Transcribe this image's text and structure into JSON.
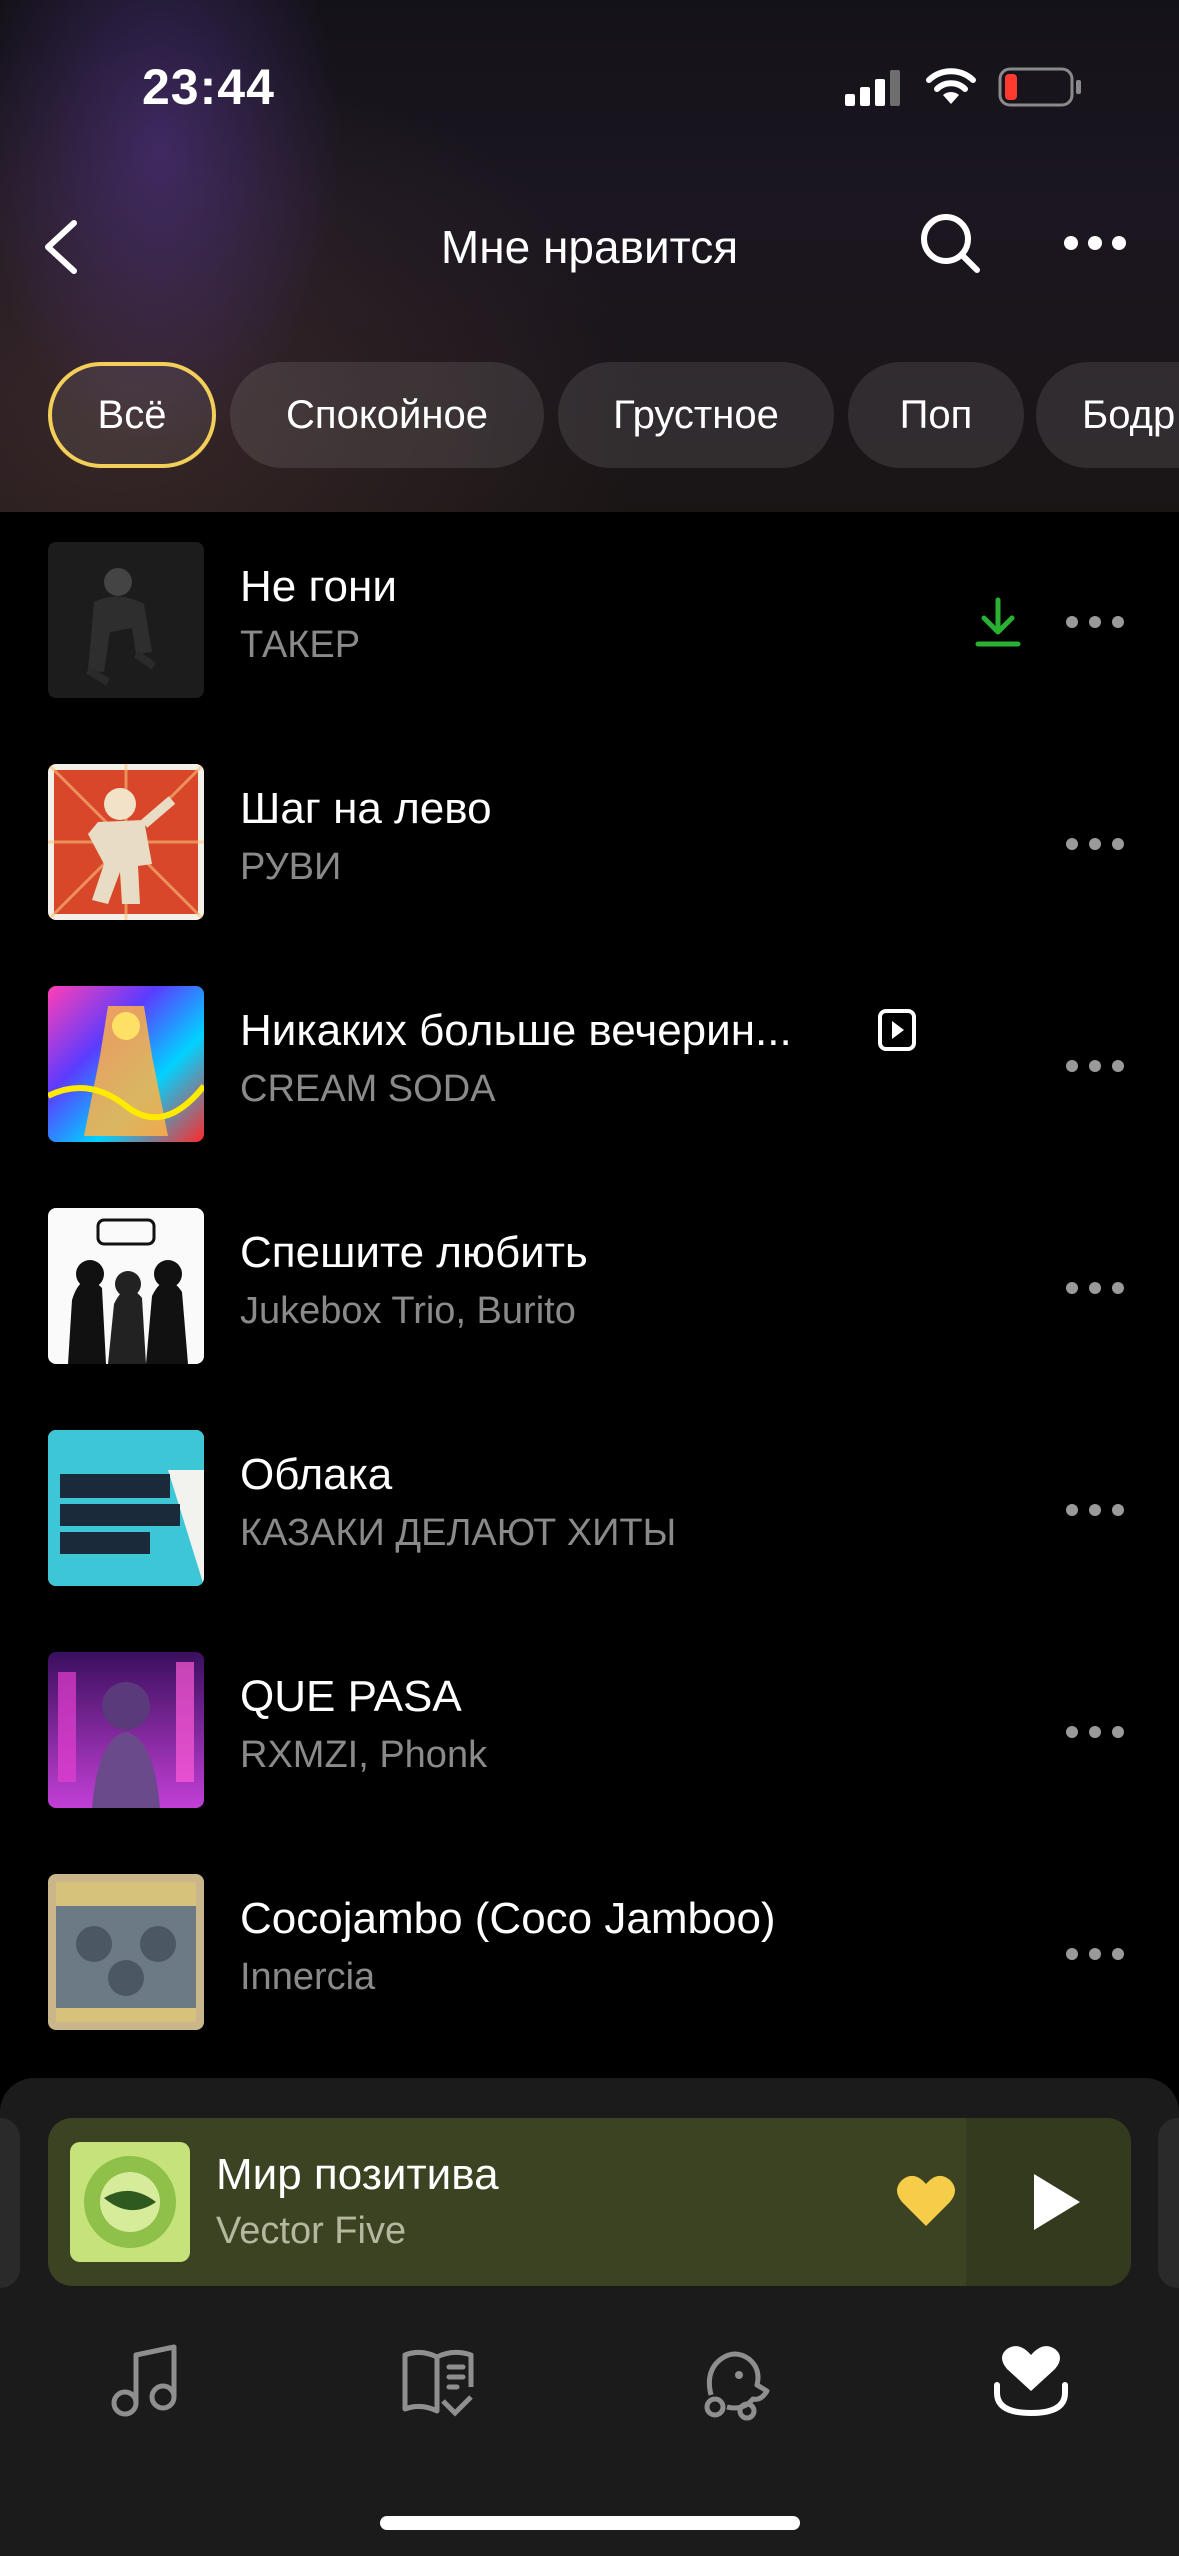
{
  "status_bar": {
    "time": "23:44"
  },
  "header": {
    "title": "Мне нравится"
  },
  "filters": [
    {
      "label": "Всё",
      "active": true
    },
    {
      "label": "Спокойное",
      "active": false
    },
    {
      "label": "Грустное",
      "active": false
    },
    {
      "label": "Поп",
      "active": false
    },
    {
      "label": "Бодр",
      "active": false
    }
  ],
  "tracks": [
    {
      "title": "Не гони",
      "artist": "ТАКЕР",
      "downloaded": true,
      "cover_icon": "album-cover-taker"
    },
    {
      "title": "Шаг на лево",
      "artist": "РУВИ",
      "cover_icon": "album-cover-ruvi"
    },
    {
      "title": "Никаких больше вечерин...",
      "artist": "CREAM SODA",
      "has_video": true,
      "cover_icon": "album-cover-cream-soda"
    },
    {
      "title": "Спешите любить",
      "artist": "Jukebox Trio, Burito",
      "cover_icon": "album-cover-jukebox"
    },
    {
      "title": "Облака",
      "artist": "КАЗАКИ ДЕЛАЮТ ХИТЫ",
      "cover_icon": "album-cover-kazaki"
    },
    {
      "title": "QUE PASA",
      "artist": "RXMZI, Phonk",
      "cover_icon": "album-cover-que-pasa"
    },
    {
      "title": "Cocojambo (Coco Jamboo)",
      "artist": "Innercia",
      "cover_icon": "album-cover-innercia"
    }
  ],
  "now_playing": {
    "title": "Мир позитива",
    "artist": "Vector Five",
    "liked": true
  },
  "tabs": [
    {
      "icon": "music-note-icon"
    },
    {
      "icon": "podcasts-book-icon"
    },
    {
      "icon": "kids-icon"
    },
    {
      "icon": "collection-heart-icon",
      "active": true
    }
  ],
  "colors": {
    "accent": "#f3cf5a",
    "download": "#2ab033",
    "secondary_text": "#8a8a8a",
    "mini_player_bg": "#3c4322"
  }
}
